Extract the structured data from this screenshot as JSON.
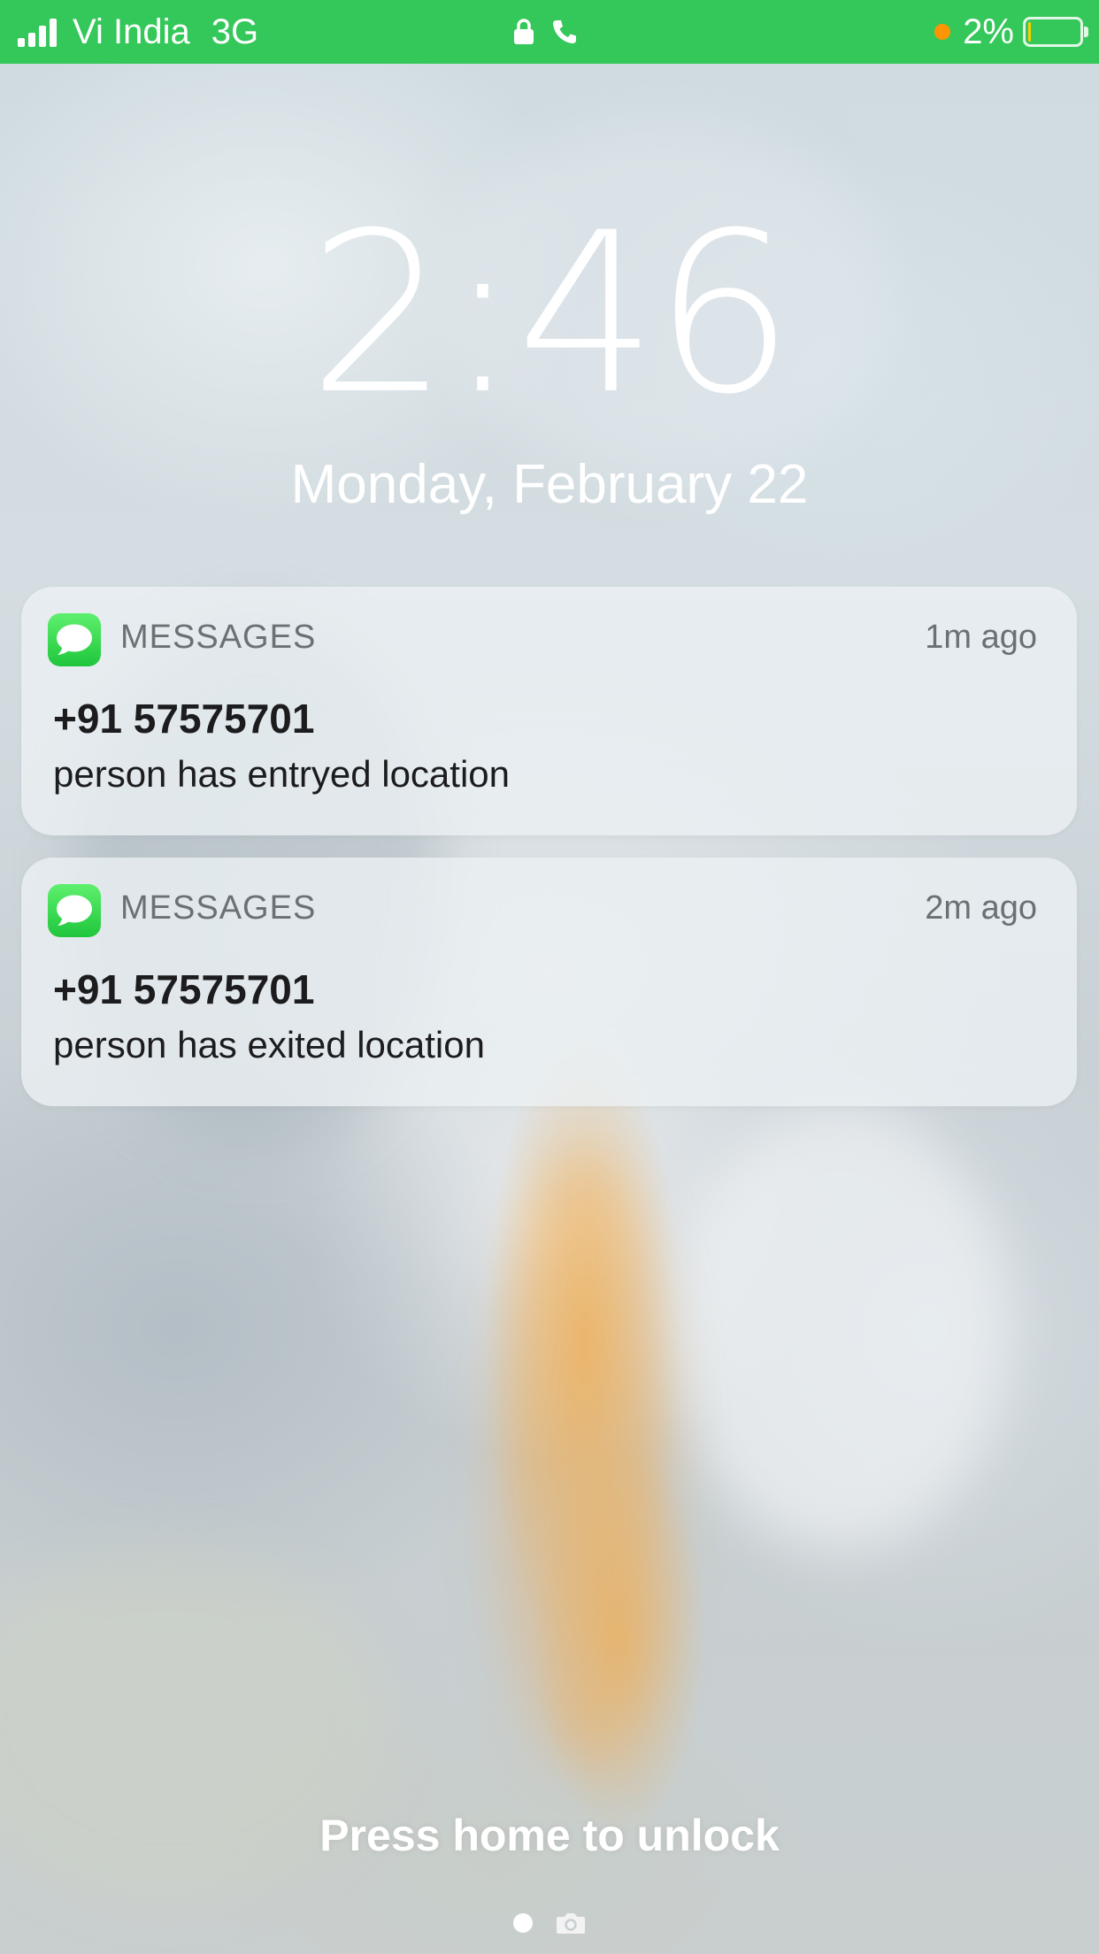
{
  "status_bar": {
    "carrier": "Vi India",
    "network": "3G",
    "battery_percent": "2%",
    "battery_level": 0.02,
    "icons": [
      "signal-bars-icon",
      "lock-icon",
      "phone-icon",
      "orange-dot-indicator",
      "battery-icon"
    ]
  },
  "lock_screen": {
    "time": "2:46",
    "date": "Monday, February 22",
    "unlock_prompt": "Press home to unlock"
  },
  "notifications": [
    {
      "app": "MESSAGES",
      "time_ago": "1m ago",
      "sender": "+91 57575701",
      "body": "person has entryed location",
      "icon": "messages-app-icon"
    },
    {
      "app": "MESSAGES",
      "time_ago": "2m ago",
      "sender": "+91 57575701",
      "body": "person has exited location",
      "icon": "messages-app-icon"
    }
  ],
  "bottom": {
    "indicators": [
      "page-dot-icon",
      "camera-icon"
    ]
  },
  "colors": {
    "status_bar_bg": "#34c759",
    "messages_icon": "#2bd34a",
    "recording_dot": "#ff9500",
    "battery_low": "#ffcc00"
  }
}
